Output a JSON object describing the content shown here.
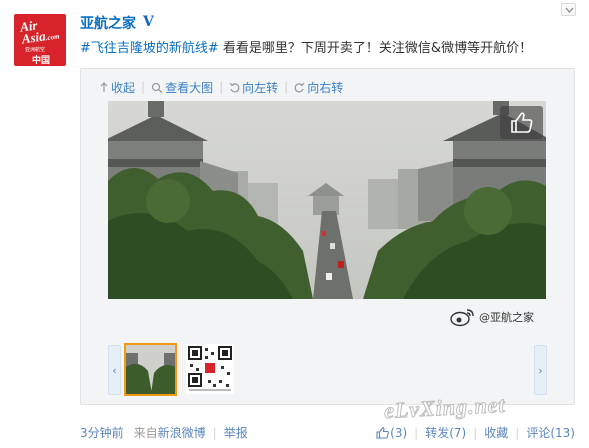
{
  "avatar": {
    "logo_line1": "Air",
    "logo_line2": "Asia",
    "logo_suffix": ".com",
    "tagline": "亚洲航空",
    "country": "中国"
  },
  "post": {
    "username": "亚航之家",
    "verified_mark": "V",
    "topic": "#飞往吉隆坡的新航线#",
    "text": " 看看是哪里？下周开卖了！关注微信&微博等开航价！"
  },
  "toolbar": {
    "collapse_label": "收起",
    "view_large_label": "查看大图",
    "rotate_left_label": "向左转",
    "rotate_right_label": "向右转"
  },
  "image_watermark": {
    "handle": "@亚航之家"
  },
  "thumbnails": {
    "prev_glyph": "‹",
    "next_glyph": "›"
  },
  "footer": {
    "time": "3分钟前",
    "from_label": "来自",
    "source": "新浪微博",
    "report": "举报"
  },
  "actions": {
    "like_count": "(3)",
    "repost_label": "转发",
    "repost_count": "(7)",
    "favorite_label": "收藏",
    "comment_label": "评论",
    "comment_count": "(13)"
  },
  "site_watermark": "eLvXing.net",
  "colors": {
    "link_blue": "#0a6fc4",
    "avatar_red": "#d8232a",
    "thumb_highlight": "#f19a11"
  }
}
